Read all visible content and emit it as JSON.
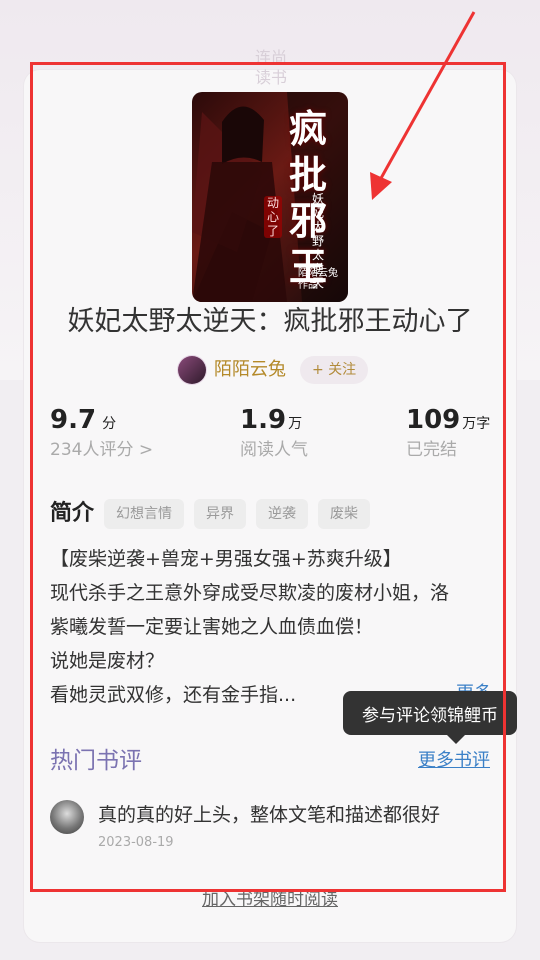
{
  "watermark": "连尚\n读书",
  "book": {
    "title": "妖妃太野太逆天：疯批邪王动心了",
    "cover": {
      "big_text": "疯批邪王",
      "sub_text": "动心了",
      "vertical_text": "妖妃太野太逆天",
      "author_text": "陌陌云兔\n作品"
    }
  },
  "author": {
    "name": "陌陌云兔",
    "follow_label": "+ 关注"
  },
  "stats": {
    "rating_value": "9.7",
    "rating_unit": "分",
    "rating_label": "234人评分 >",
    "popularity_value": "1.9",
    "popularity_unit": "万",
    "popularity_label": "阅读人气",
    "words_value": "109",
    "words_unit": "万字",
    "words_label": "已完结"
  },
  "intro": {
    "title": "简介",
    "tags": [
      "幻想言情",
      "异界",
      "逆袭",
      "废柴"
    ],
    "lines": [
      "【废柴逆袭+兽宠+男强女强+苏爽升级】",
      "现代杀手之王意外穿成受尽欺凌的废材小姐，洛",
      "紫曦发誓一定要让害她之人血债血偿！",
      "说她是废材？",
      "看她灵武双修，还有金手指..."
    ],
    "more_label": "更多"
  },
  "tooltip": "参与评论领锦鲤币",
  "reviews": {
    "title": "热门书评",
    "more_label": "更多书评",
    "items": [
      {
        "text": "真的真的好上头，整体文笔和描述都很好",
        "date": "2023-08-19"
      }
    ]
  },
  "bottom_link": "加入书架随时阅读",
  "colors": {
    "annotation": "#ee3333",
    "author_gold": "#b48a2a",
    "link_blue": "#3b80c7",
    "reviews_purple": "#7b73b1"
  }
}
